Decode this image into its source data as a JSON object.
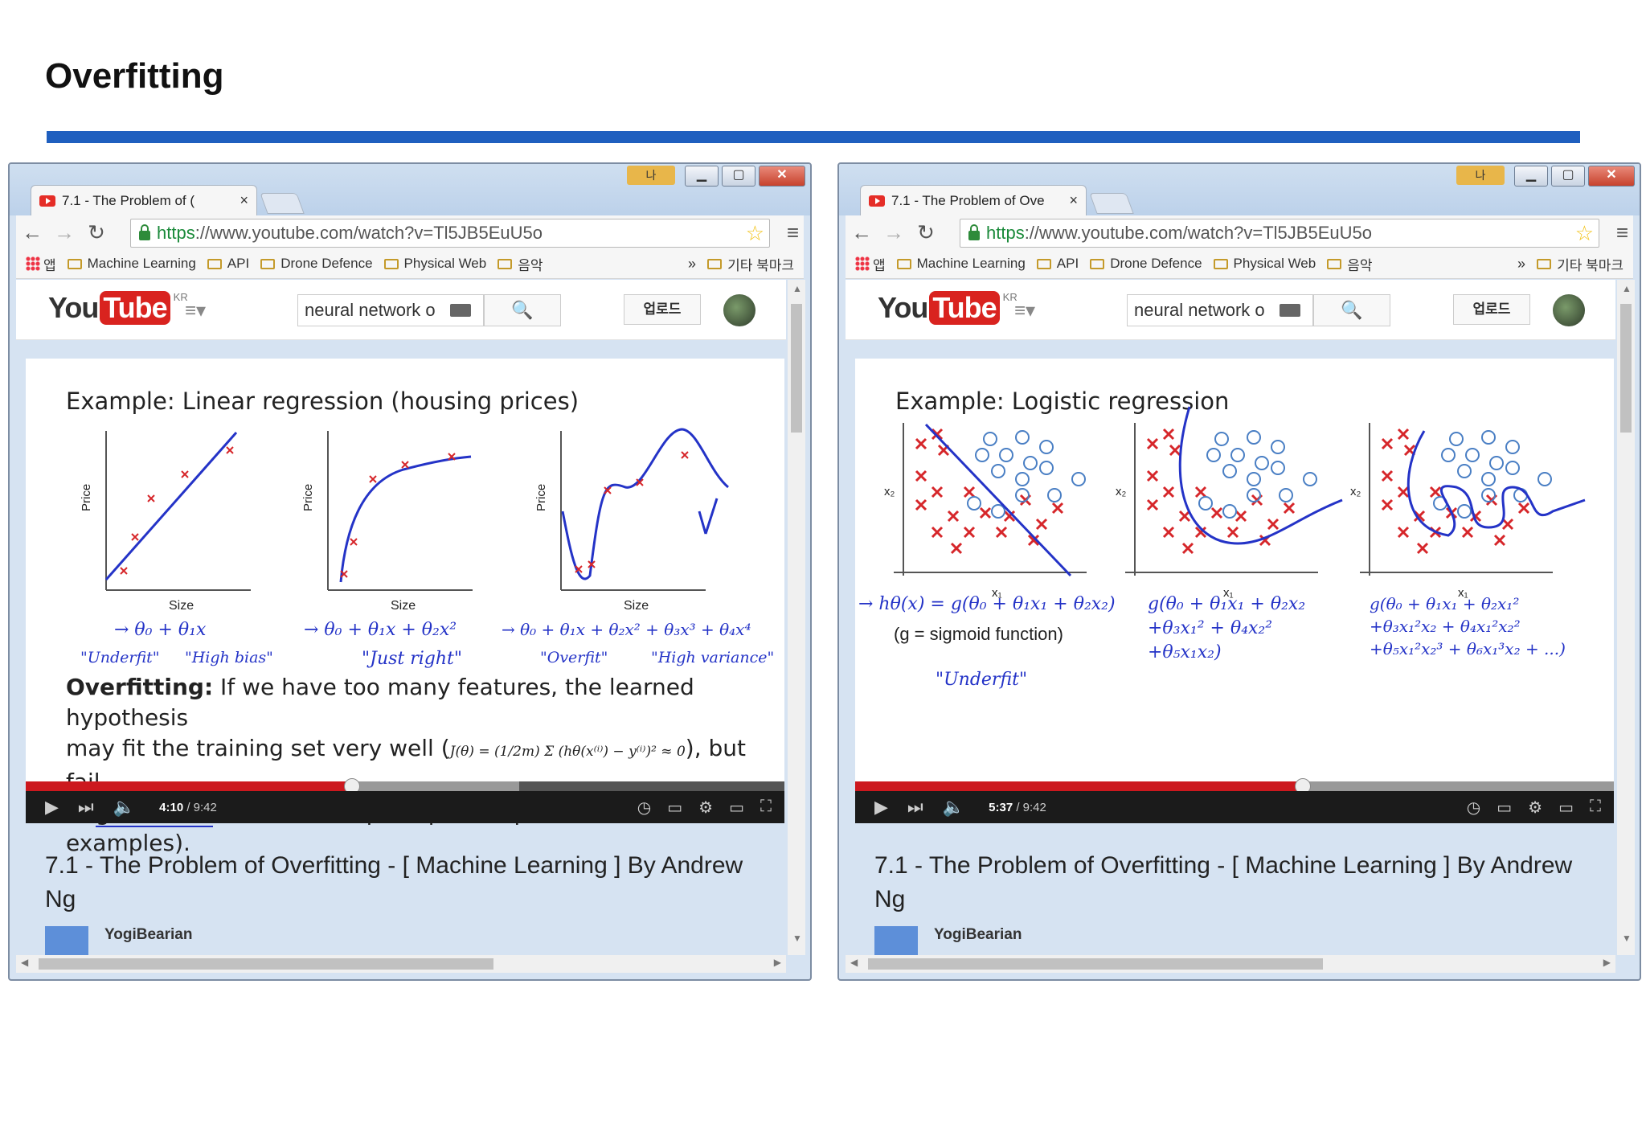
{
  "page": {
    "title": "Overfitting"
  },
  "browser": {
    "tab_label_left": "7.1 - The Problem of (",
    "tab_label_right": "7.1 - The Problem of Ove",
    "tab_close": "×",
    "user_badge": "나",
    "min": "▁",
    "max": "▢",
    "close": "✕",
    "back": "←",
    "forward": "→",
    "reload": "↻",
    "url_protocol": "https",
    "url_rest": "://www.youtube.com/watch?v=Tl5JB5EuU5o",
    "star": "☆",
    "menu": "≡",
    "bookmarks": [
      "Machine Learning",
      "API",
      "Drone Defence",
      "Physical Web",
      "음악"
    ],
    "apps_label": "앱",
    "more": "»",
    "other_bookmarks": "기타 북마크"
  },
  "youtube": {
    "logo_you": "You",
    "logo_tube": "Tube",
    "logo_region": "KR",
    "guide": "≡▾",
    "search_value": "neural network o",
    "search_icon": "🔍",
    "upload_label": "업로드",
    "video_title": "7.1 - The Problem of Overfitting - [ Machine Learning ] By Andrew Ng",
    "channel": "YogiBearian"
  },
  "left": {
    "heading": "Example: Linear regression (housing prices)",
    "ylabel": "Price",
    "xlabel": "Size",
    "eq1": "→ θ₀ + θ₁x",
    "eq2": "→ θ₀ + θ₁x + θ₂x²",
    "eq3": "→ θ₀ + θ₁x + θ₂x² + θ₃x³ + θ₄x⁴",
    "note1a": "\"Underfit\"",
    "note1b": "\"High bias\"",
    "note2": "\"Just right\"",
    "note3a": "\"Overfit\"",
    "note3b": "\"High variance\"",
    "para_bold": "Overfitting:",
    "para_1": " If we have too many features, the learned hypothesis",
    "para_2a": "may fit the training set very well (",
    "para_formula": "J(θ) = (1/2m) Σ (hθ(x⁽ⁱ⁾) − y⁽ⁱ⁾)² ≈ 0",
    "para_2b": "), but fail",
    "para_3a": "to ",
    "para_3u": "generalize",
    "para_3b": " to new examples (predict prices on new examples).",
    "time_current": "4:10",
    "time_total": " / 9:42",
    "progress": 0.43,
    "buffered": 0.65
  },
  "right": {
    "heading": "Example: Logistic regression",
    "ylabel": "x₂",
    "xlabel": "x₁",
    "eq1": "→ hθ(x) = g(θ₀ + θ₁x₁ + θ₂x₂)",
    "eq1b": "(g = sigmoid function)",
    "note1": "\"Underfit\"",
    "eq2a": "g(θ₀ + θ₁x₁ + θ₂x₂",
    "eq2b": "+θ₃x₁² + θ₄x₂²",
    "eq2c": "+θ₅x₁x₂)",
    "eq3a": "g(θ₀ + θ₁x₁ + θ₂x₁²",
    "eq3b": "+θ₃x₁²x₂ + θ₄x₁²x₂²",
    "eq3c": "+θ₅x₁²x₂³ + θ₆x₁³x₂ + ...)",
    "time_current": "5:37",
    "time_total": " / 9:42",
    "progress": 0.59,
    "buffered": 1.0
  },
  "colors": {
    "accent_rule": "#1f5fbf",
    "youtube_red": "#cc181e",
    "handwriting": "#2433c7",
    "cross": "#d6262a",
    "circle": "#4a7fc4"
  }
}
